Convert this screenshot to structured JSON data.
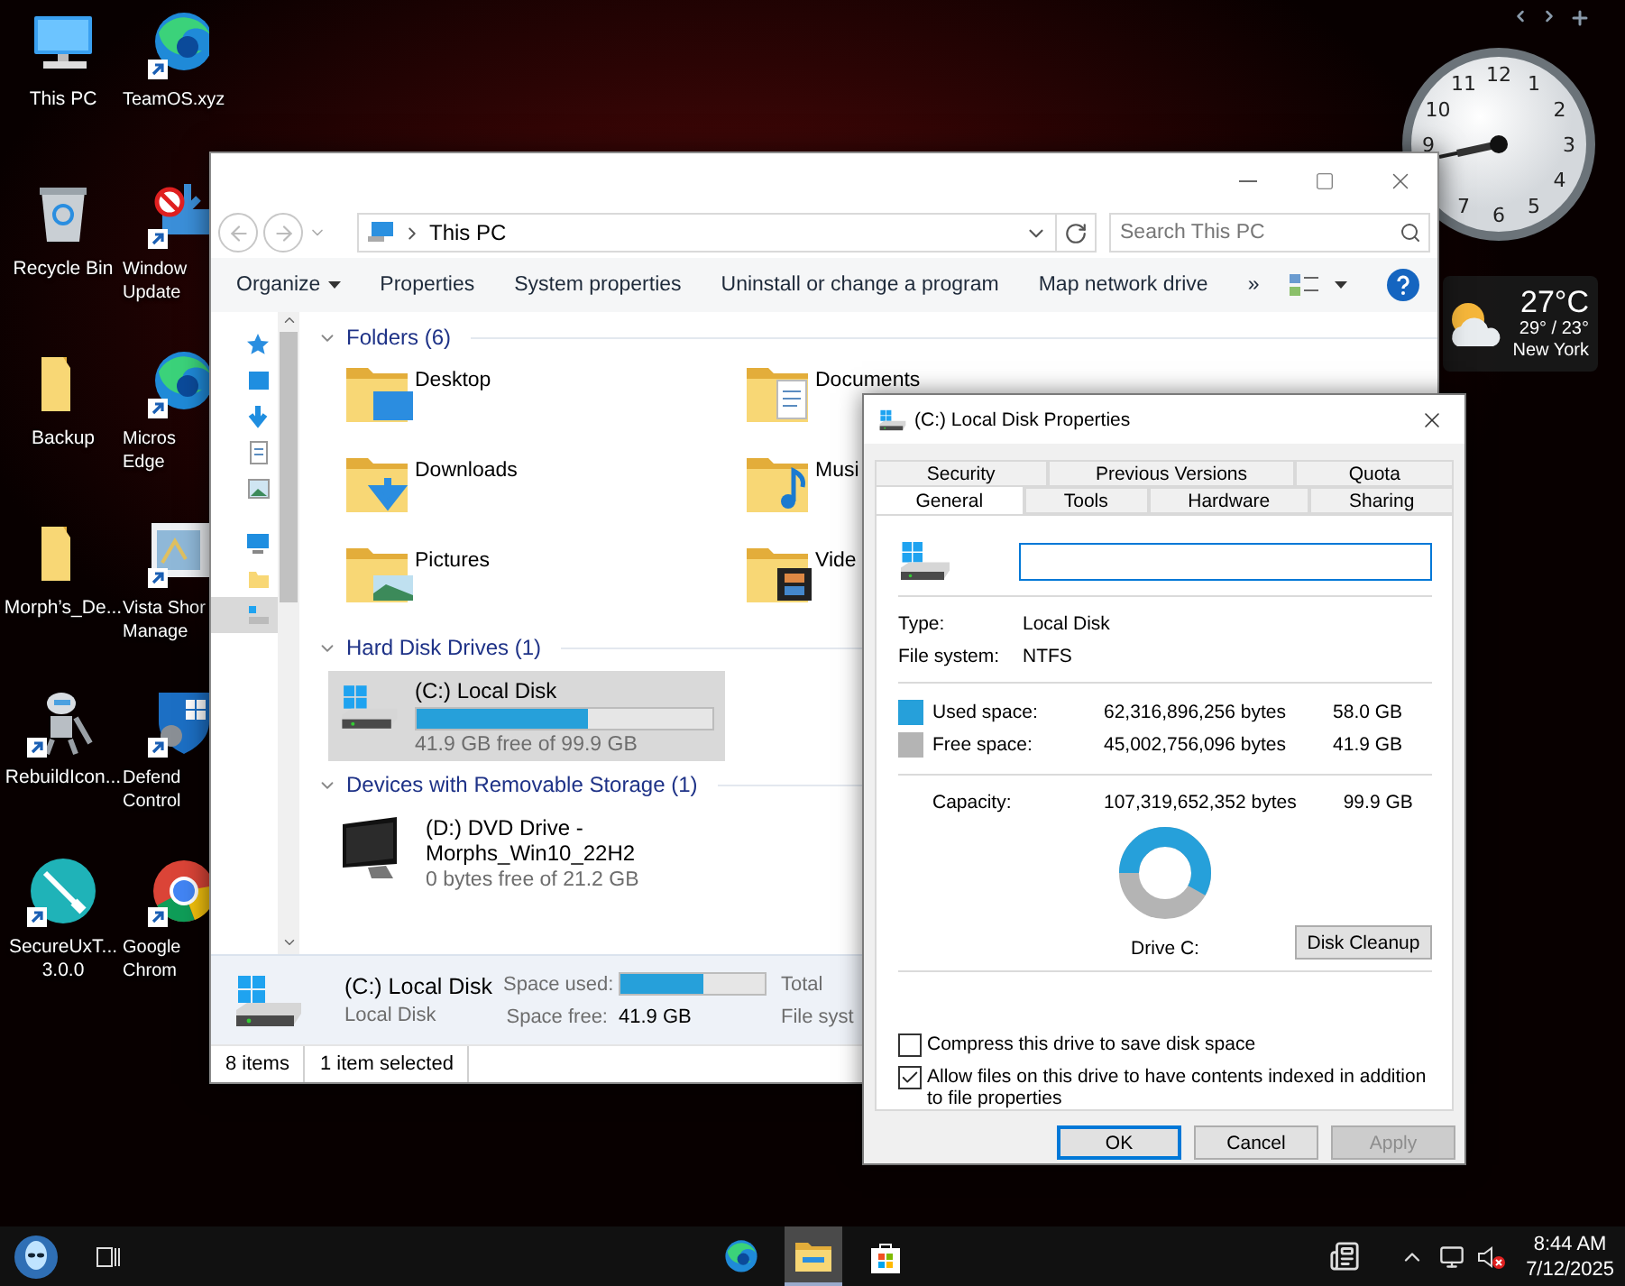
{
  "desktop_icons": [
    {
      "lines": [
        "This PC"
      ],
      "shortcut": false
    },
    {
      "lines": [
        "TeamOS.xyz"
      ],
      "shortcut": true
    },
    {
      "lines": [
        "Recycle Bin"
      ],
      "shortcut": false
    },
    {
      "lines": [
        "Window",
        "Update"
      ],
      "shortcut": true
    },
    {
      "lines": [
        "Backup"
      ],
      "shortcut": false
    },
    {
      "lines": [
        "Micros",
        "Edge"
      ],
      "shortcut": true
    },
    {
      "lines": [
        "Morph’s_De..."
      ],
      "shortcut": false
    },
    {
      "lines": [
        "Vista Shor",
        "Manage"
      ],
      "shortcut": true
    },
    {
      "lines": [
        "RebuildIcon..."
      ],
      "shortcut": true
    },
    {
      "lines": [
        "Defend",
        "Control"
      ],
      "shortcut": true
    },
    {
      "lines": [
        "SecureUxT...",
        "3.0.0"
      ],
      "shortcut": true
    },
    {
      "lines": [
        "Google",
        "Chrom"
      ],
      "shortcut": true
    }
  ],
  "explorer": {
    "address": "This PC",
    "search": {
      "placeholder": "Search This PC"
    },
    "commands": [
      {
        "label": "Organize",
        "menu": true
      },
      {
        "label": "Properties",
        "menu": false
      },
      {
        "label": "System properties",
        "menu": false
      },
      {
        "label": "Uninstall or change a program",
        "menu": false
      },
      {
        "label": "Map network drive",
        "menu": false
      },
      {
        "label": "»",
        "menu": false
      }
    ],
    "nav_pane": [
      {
        "selected": false
      },
      {
        "selected": false
      },
      {
        "selected": false
      },
      {
        "selected": false
      },
      {
        "selected": false
      },
      {
        "selected": false
      },
      {
        "selected": false
      },
      {
        "selected": true
      }
    ],
    "groups": [
      {
        "title": "Folders (6)",
        "kind": "folders",
        "items": [
          {
            "name": "Desktop"
          },
          {
            "name": "Documents"
          },
          {
            "name": "Downloads"
          },
          {
            "name": "Musi"
          },
          {
            "name": "Pictures"
          },
          {
            "name": "Vide"
          }
        ]
      },
      {
        "title": "Hard Disk Drives (1)",
        "kind": "drives",
        "items": [
          {
            "name": "(C:) Local Disk",
            "level": 0.58,
            "info": "41.9 GB free of 99.9 GB",
            "selected": true
          }
        ]
      },
      {
        "title": "Devices with Removable Storage (1)",
        "kind": "drives",
        "items": [
          {
            "name": "(D:) DVD Drive - Morphs_Win10_22H2",
            "info": "0 bytes free of 21.2 GB",
            "selected": false
          }
        ]
      }
    ],
    "details": {
      "name": "(C:) Local Disk",
      "type": "Local Disk",
      "rows": [
        {
          "label": "Space used:",
          "kind": "bar",
          "level": 0.58,
          "label_2": "Total"
        },
        {
          "label": "Space free:",
          "kind": "text",
          "value": "41.9 GB",
          "label_2": "File syst"
        }
      ]
    },
    "status_bar": [
      "8 items",
      "1 item selected"
    ]
  },
  "dialog": {
    "title": "(C:) Local Disk Properties",
    "tab_rows": [
      [
        {
          "label": "Security",
          "selected": false
        },
        {
          "label": "Previous Versions",
          "selected": false
        },
        {
          "label": "Quota",
          "selected": false
        }
      ],
      [
        {
          "label": "General",
          "selected": true
        },
        {
          "label": "Tools",
          "selected": false
        },
        {
          "label": "Hardware",
          "selected": false
        },
        {
          "label": "Sharing",
          "selected": false
        }
      ]
    ],
    "info": [
      {
        "label": "Type:",
        "value": "Local Disk"
      },
      {
        "label": "File system:",
        "value": "NTFS"
      }
    ],
    "space": [
      {
        "label": "Used space:",
        "bytes": "62,316,896,256 bytes",
        "size": "58.0 GB",
        "color": "#26a0da"
      },
      {
        "label": "Free space:",
        "bytes": "45,002,756,096 bytes",
        "size": "41.9 GB",
        "color": "#b4b4b4"
      }
    ],
    "capacity": {
      "label": "Capacity:",
      "bytes": "107,319,652,352 bytes",
      "size": "99.9 GB",
      "level": 0.58
    },
    "drive_label": "Drive C:",
    "cleanup_button": "Disk Cleanup",
    "options": [
      {
        "label": "Compress this drive to save disk space",
        "checked": false
      },
      {
        "label": "Allow files on this drive to have contents indexed in addition to file properties",
        "checked": true
      }
    ],
    "buttons": [
      {
        "label": "OK",
        "default": true,
        "disabled": false
      },
      {
        "label": "Cancel",
        "default": false,
        "disabled": false
      },
      {
        "label": "Apply",
        "default": false,
        "disabled": true
      }
    ]
  },
  "clock": {
    "numerals": [
      "12",
      "11",
      "1",
      "10",
      "2",
      "9",
      "3",
      "4",
      "7",
      "5",
      "6"
    ]
  },
  "weather": {
    "temperature": "27°C",
    "range": "29° / 23°",
    "city": "New York"
  },
  "taskbar": {
    "apps": [
      {
        "selected": false
      },
      {
        "selected": true
      },
      {
        "selected": false
      }
    ],
    "muted": true,
    "time": "8:44 AM",
    "date": "7/12/2025"
  }
}
